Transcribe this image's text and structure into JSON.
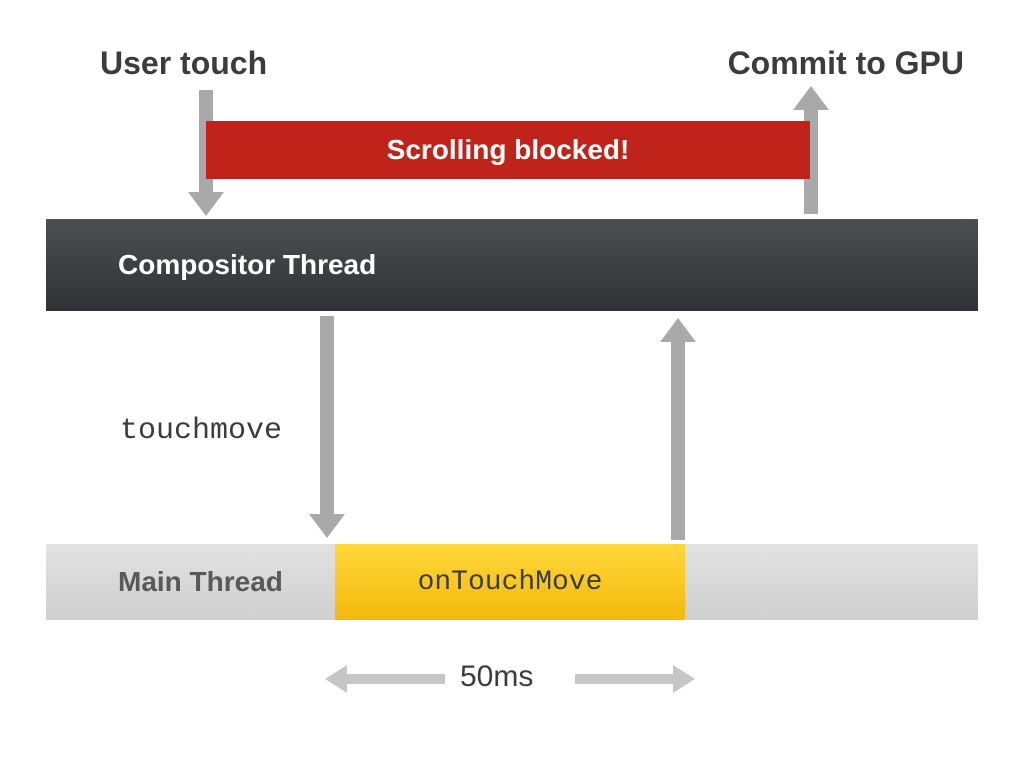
{
  "labels": {
    "user_touch": "User touch",
    "commit_gpu": "Commit to GPU",
    "scrolling_blocked": "Scrolling blocked!",
    "compositor_thread": "Compositor Thread",
    "touchmove": "touchmove",
    "main_thread": "Main Thread",
    "on_touch_move": "onTouchMove",
    "duration": "50ms"
  },
  "colors": {
    "arrow": "#a9a9a9",
    "banner": "#c0231a",
    "handler": "#f7c317",
    "compositor_top": "#4c4e52",
    "compositor_bottom": "#303236",
    "main_bg": "#d7d7d7"
  },
  "chart_data": {
    "type": "timeline",
    "lanes": [
      {
        "name": "Compositor Thread",
        "events": []
      },
      {
        "name": "Main Thread",
        "events": [
          {
            "label": "onTouchMove",
            "duration_ms": 50
          }
        ]
      }
    ],
    "flows": [
      {
        "from": "User touch",
        "to": "Compositor Thread",
        "label": ""
      },
      {
        "from": "Compositor Thread",
        "to": "Main Thread",
        "label": "touchmove"
      },
      {
        "from": "Main Thread",
        "to": "Compositor Thread",
        "label": ""
      },
      {
        "from": "Compositor Thread",
        "to": "Commit to GPU",
        "label": ""
      }
    ],
    "blocked_span": {
      "label": "Scrolling blocked!",
      "from": "User touch",
      "to": "Commit to GPU"
    },
    "handler_duration_ms": 50
  }
}
